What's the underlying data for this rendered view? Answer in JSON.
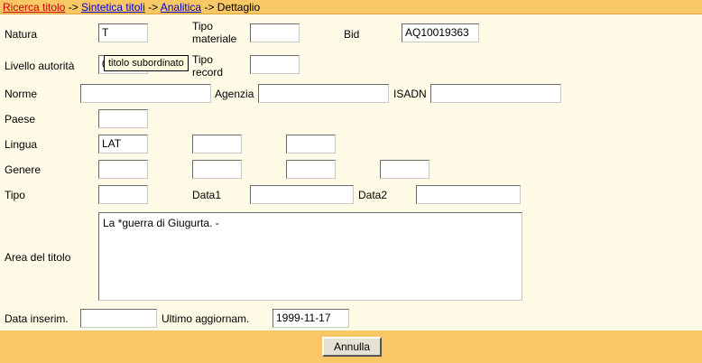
{
  "breadcrumb": {
    "ricerca": "Ricerca titolo",
    "sep1": " -> ",
    "sintetica": "Sintetica titoli",
    "sep2": " -> ",
    "analitica": "Analitica",
    "sep3": " -> ",
    "current": "Dettaglio"
  },
  "labels": {
    "natura": "Natura",
    "tipo_materiale_1": "Tipo",
    "tipo_materiale_2": "materiale",
    "bid": "Bid",
    "livello_autorita": "Livello autorità",
    "tipo_record_1": "Tipo",
    "tipo_record_2": "record",
    "norme": "Norme",
    "agenzia": "Agenzia",
    "isadn": "ISADN",
    "paese": "Paese",
    "lingua": "Lingua",
    "genere": "Genere",
    "tipo": "Tipo",
    "data1": "Data1",
    "data2": "Data2",
    "area_titolo": "Area del titolo",
    "data_inserim": "Data inserim.",
    "ultimo_aggiornam": "Ultimo aggiornam."
  },
  "fields": {
    "natura": "T",
    "tipo_materiale": "",
    "bid": "AQ10019363",
    "livello_autorita": "05",
    "tipo_record": "",
    "norme": "",
    "agenzia": "",
    "isadn": "",
    "paese": "",
    "lingua_1": "LAT",
    "lingua_2": "",
    "lingua_3": "",
    "genere_1": "",
    "genere_2": "",
    "genere_3": "",
    "genere_4": "",
    "tipo": "",
    "data1": "",
    "data2": "",
    "area_titolo": "La *guerra di Giugurta. -",
    "data_inserim": "",
    "ultimo_aggiornam": "1999-11-17"
  },
  "tooltip": "titolo subordinato",
  "buttons": {
    "annulla": "Annulla"
  },
  "colors": {
    "bar": "#f8c866",
    "background": "#fffbe6",
    "link": "#0000cc",
    "link_first": "#cc0000"
  }
}
